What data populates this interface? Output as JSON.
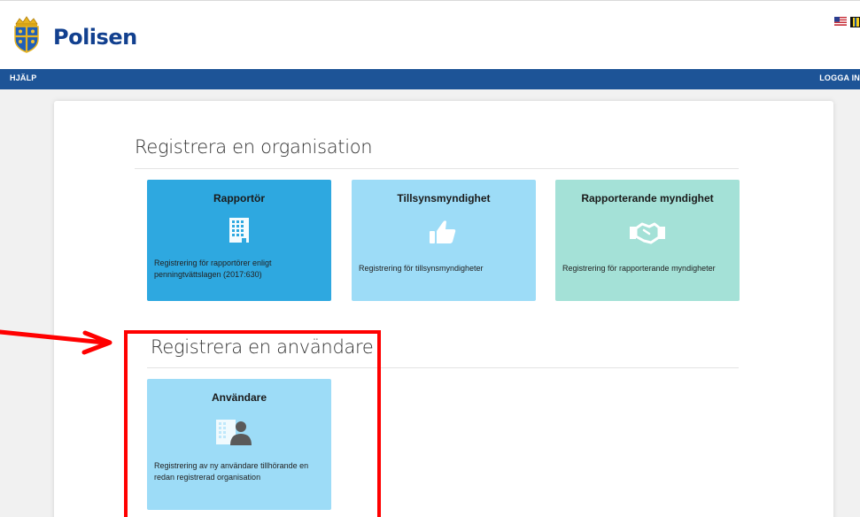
{
  "header": {
    "logo_text": "Polisen",
    "logo_icon": "crown-shield-emblem-icon",
    "language_flags": [
      "us-flag-icon",
      "sweden-flag-icon"
    ]
  },
  "nav": {
    "help": "HJÄLP",
    "login": "LOGGA IN"
  },
  "sections": {
    "organisation_title": "Registrera en organisation",
    "user_title": "Registrera en användare"
  },
  "tiles": {
    "reporter": {
      "title": "Rapportör",
      "description": "Registrering för rapportörer enligt penningtvättslagen (2017:630)",
      "icon": "building-icon",
      "color": "#2ea8e0"
    },
    "supervisory": {
      "title": "Tillsynsmyndighet",
      "description": "Registrering för tillsynsmyndigheter",
      "icon": "thumbs-up-icon",
      "color": "#9ddcf7"
    },
    "reporting_authority": {
      "title": "Rapporterande myndighet",
      "description": "Registrering för rapporterande myndigheter",
      "icon": "handshake-icon",
      "color": "#a4e1d7"
    },
    "user": {
      "title": "Användare",
      "description": "Registrering av ny användare tillhörande en redan registrerad organisation",
      "icon": "user-building-icon",
      "color": "#9ddcf7"
    }
  },
  "colors": {
    "navbar": "#1d5497",
    "brand_text": "#12408f",
    "annotation": "#ff0000"
  }
}
